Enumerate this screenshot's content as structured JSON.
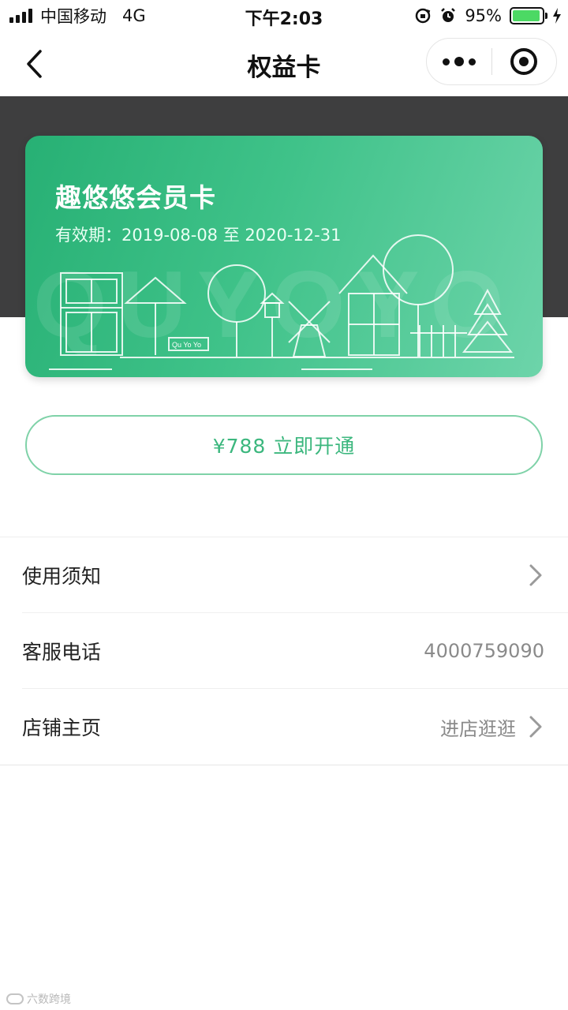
{
  "status_bar": {
    "carrier": "中国移动",
    "network": "4G",
    "time": "下午2:03",
    "battery_percent": "95%",
    "battery_level": 0.95,
    "icons": [
      "signal-icon",
      "lock-rotation-icon",
      "alarm-icon",
      "battery-icon",
      "charging-icon"
    ]
  },
  "nav": {
    "title": "权益卡",
    "icons": [
      "back-arrow-icon",
      "more-dots-icon",
      "close-target-icon"
    ]
  },
  "card": {
    "name": "趣悠悠会员卡",
    "validity": "有效期：2019-08-08 至 2020-12-31",
    "watermark_text": "QUYOYO",
    "shop_sign": "Qu Yo Yo",
    "colors": {
      "start": "#27b074",
      "end": "#6dd4aa"
    }
  },
  "pay_button": {
    "label": "¥788 立即开通",
    "color": "#3cb77e"
  },
  "list": {
    "items": [
      {
        "label": "使用须知",
        "value": "",
        "has_chevron": true
      },
      {
        "label": "客服电话",
        "value": "4000759090",
        "has_chevron": false
      },
      {
        "label": "店铺主页",
        "value": "进店逛逛",
        "has_chevron": true
      }
    ]
  },
  "watermark": {
    "text": "六数跨境"
  }
}
